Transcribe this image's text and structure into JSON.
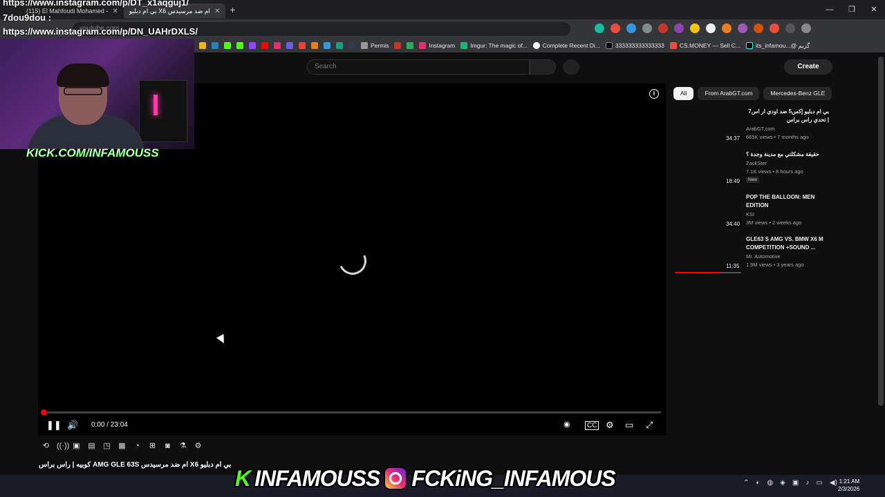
{
  "overlay": {
    "line1": "https://www.instagram.com/p/DT_x1aqguj1/",
    "line2": "7dou9dou :",
    "line3": "https://www.instagram.com/p/DN_UAHrDXLS/",
    "kick_handle": "KICK.COM/INFAMOUSS",
    "banner_kick": "INFAMOUSS",
    "banner_ig": "FCKiNG_INFAMOUS"
  },
  "browser": {
    "tabs": [
      {
        "label": "(115) El Mahfoudi Mohamed -"
      },
      {
        "label": "بي ام دبليو X6 ام ضد مرسيدس"
      }
    ],
    "address_text": "youtube.com",
    "bookmarks": [
      "Permis",
      "Instagram",
      "Imgur: The magic of...",
      "Complete Recent Di...",
      "333333333333333",
      "CS.MONEY — Sell C...",
      "its_infamou...@ گريم"
    ]
  },
  "youtube": {
    "search_placeholder": "Search",
    "create_label": "Create",
    "player": {
      "time": "0:00 / 23:04",
      "progress_fraction": 0.0
    },
    "video_title": "بي ام دبليو X6 ام ضد مرسيدس AMG GLE 63S كوبيه | راس براس",
    "chips": [
      "All",
      "From ArabGT.com",
      "Mercedes-Benz GLE"
    ],
    "recommendations": [
      {
        "title": "بي ام دبليو إكس5 ضد اودي ار اس7 | تحدي راس براس",
        "channel": "ArabGT.com",
        "meta": "665K views • 7 months ago",
        "duration": "34:37",
        "badge": ""
      },
      {
        "title": "حقيقة مشكلتي مع مدينة وجدة ؟",
        "channel": "ZackSter",
        "meta": "7.1K views • 8 hours ago",
        "duration": "18:49",
        "badge": "New"
      },
      {
        "title": "POP THE BALLOON: MEN EDITION",
        "channel": "KSI",
        "meta": "3M views • 2 weeks ago",
        "duration": "34:40",
        "badge": ""
      },
      {
        "title": "GLE63 S AMG VS. BMW X6 M COMPETITION +SOUND ...",
        "channel": "Mr. Automotive",
        "meta": "1.9M views • 3 years ago",
        "duration": "11:35",
        "badge": "",
        "watched_fraction": 0.68
      }
    ]
  },
  "taskbar": {
    "time": "1:21 AM",
    "date": "2/3/2026"
  }
}
